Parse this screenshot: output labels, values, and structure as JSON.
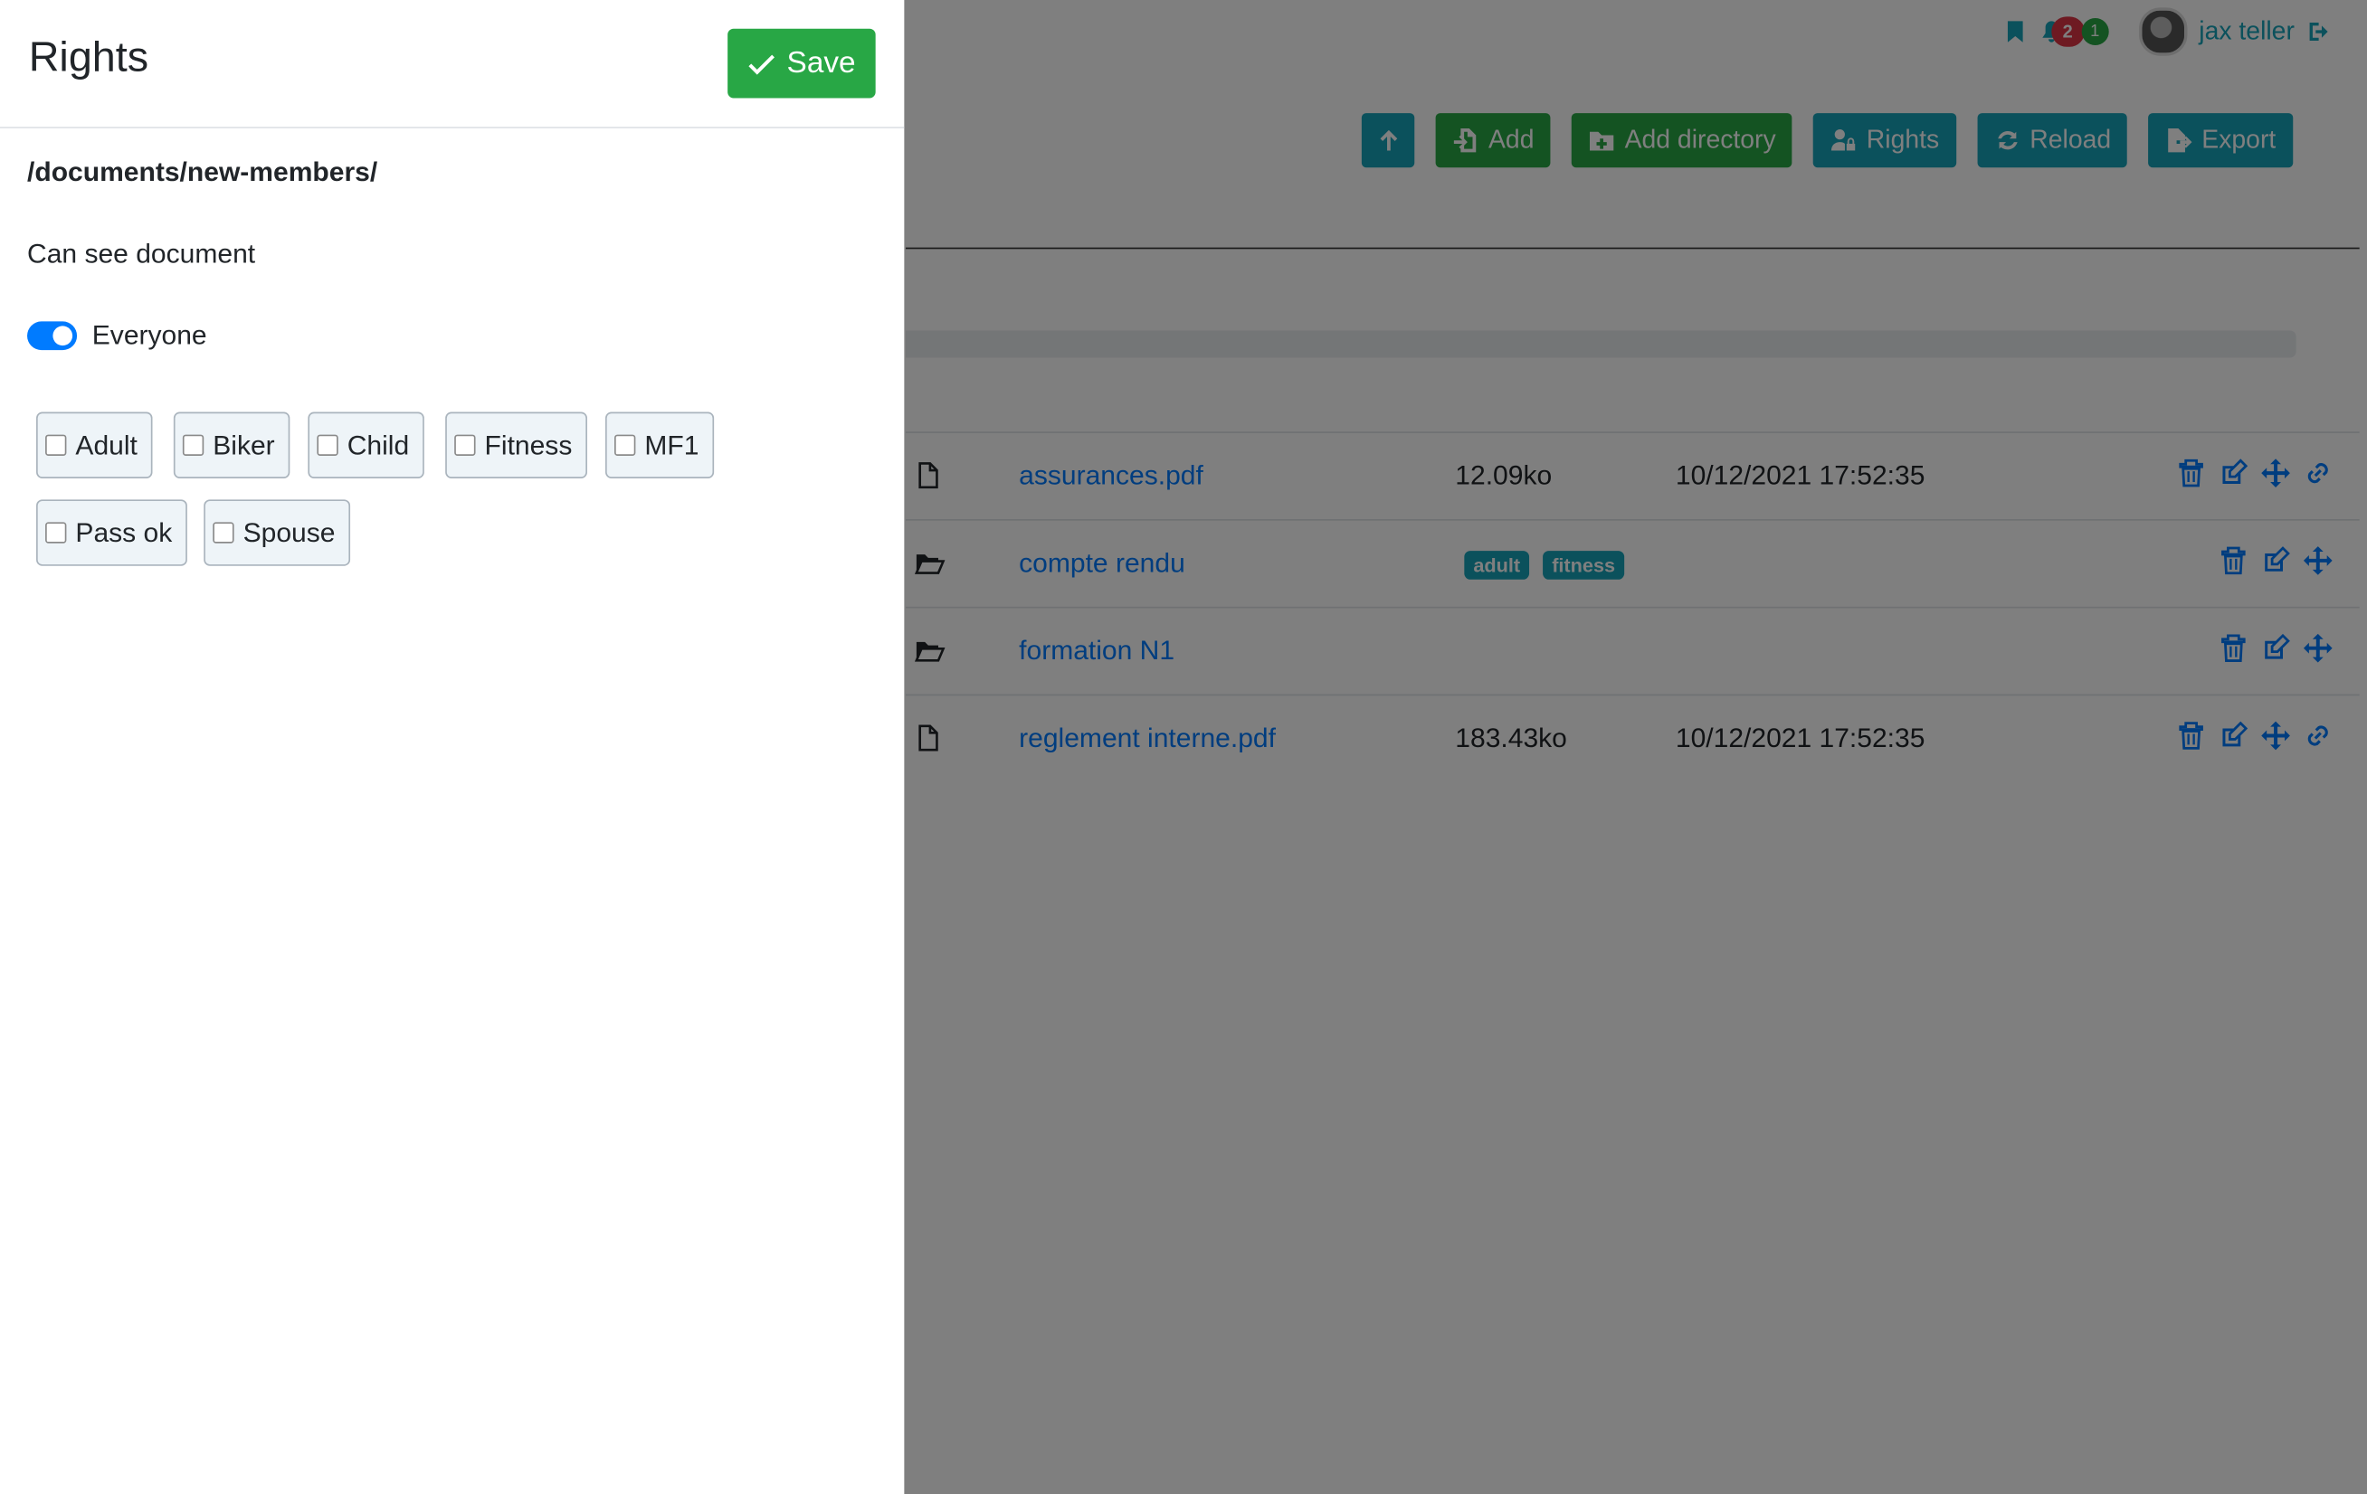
{
  "user": {
    "name": "jax teller",
    "notifications_count": "2",
    "messages_count": "1"
  },
  "toolbar": {
    "up_label": "",
    "add_label": "Add",
    "add_directory_label": "Add directory",
    "rights_label": "Rights",
    "reload_label": "Reload",
    "export_label": "Export"
  },
  "files": [
    {
      "type": "file",
      "name": "assurances.pdf",
      "size": "12.09ko",
      "date": "10/12/2021 17:52:35",
      "tags": []
    },
    {
      "type": "folder",
      "name": "compte rendu",
      "size": "",
      "date": "",
      "tags": [
        "adult",
        "fitness"
      ]
    },
    {
      "type": "folder",
      "name": "formation N1",
      "size": "",
      "date": "",
      "tags": []
    },
    {
      "type": "file",
      "name": "reglement interne.pdf",
      "size": "183.43ko",
      "date": "10/12/2021 17:52:35",
      "tags": []
    }
  ],
  "panel": {
    "title": "Rights",
    "save_label": "Save",
    "path": "/documents/new-members/",
    "permission_label": "Can see document",
    "everyone_label": "Everyone",
    "everyone_enabled": true,
    "groups": [
      {
        "label": "Adult",
        "checked": false
      },
      {
        "label": "Biker",
        "checked": false
      },
      {
        "label": "Child",
        "checked": false
      },
      {
        "label": "Fitness",
        "checked": false
      },
      {
        "label": "MF1",
        "checked": false
      },
      {
        "label": "Pass ok",
        "checked": false
      },
      {
        "label": "Spouse",
        "checked": false
      }
    ]
  },
  "colors": {
    "primary": "#007bff",
    "teal": "#17a2b8",
    "green": "#28a745",
    "danger": "#dc3545"
  }
}
